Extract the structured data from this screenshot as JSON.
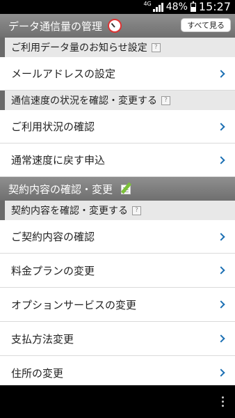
{
  "status": {
    "network": "4G",
    "battery": "48%",
    "battery_level": 0.48,
    "time": "15:27"
  },
  "sections": [
    {
      "title": "データ通信量の管理",
      "icon": "speedometer-icon",
      "action": "すべて見る"
    },
    {
      "title": "契約内容の確認・変更",
      "icon": "edit-icon"
    }
  ],
  "subsections": {
    "data_notice": {
      "title": "ご利用データ量のお知らせ設定",
      "help": "?"
    },
    "speed_status": {
      "title": "通信速度の状況を確認・変更する",
      "help": "?"
    },
    "contract": {
      "title": "契約内容を確認・変更する",
      "help": "?"
    }
  },
  "items": {
    "email_settings": "メールアドレスの設定",
    "usage_check": "ご利用状況の確認",
    "restore_speed": "通常速度に戻す申込",
    "contract_check": "ご契約内容の確認",
    "plan_change": "料金プランの変更",
    "option_change": "オプションサービスの変更",
    "payment_change": "支払方法変更",
    "address_change": "住所の変更"
  }
}
